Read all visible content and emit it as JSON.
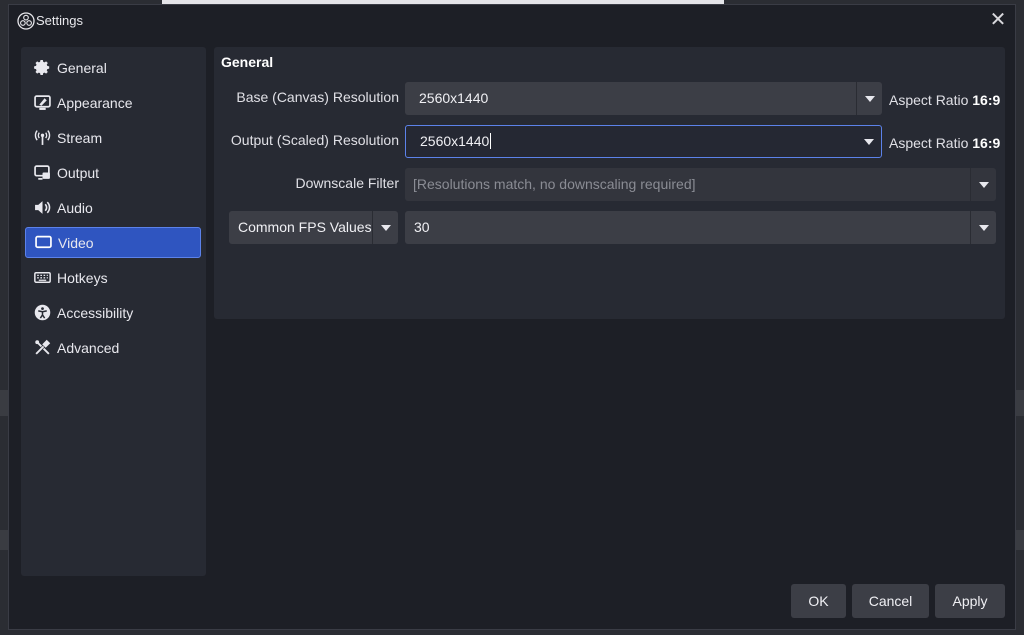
{
  "window": {
    "title": "Settings"
  },
  "sidebar": {
    "items": [
      {
        "label": "General",
        "icon": "gear-icon"
      },
      {
        "label": "Appearance",
        "icon": "appearance-icon"
      },
      {
        "label": "Stream",
        "icon": "antenna-icon"
      },
      {
        "label": "Output",
        "icon": "output-icon"
      },
      {
        "label": "Audio",
        "icon": "speaker-icon"
      },
      {
        "label": "Video",
        "icon": "monitor-icon",
        "active": true
      },
      {
        "label": "Hotkeys",
        "icon": "keyboard-icon"
      },
      {
        "label": "Accessibility",
        "icon": "accessibility-icon"
      },
      {
        "label": "Advanced",
        "icon": "tools-icon"
      }
    ]
  },
  "video": {
    "section_title": "General",
    "base_resolution": {
      "label": "Base (Canvas) Resolution",
      "value": "2560x1440",
      "aspect_label": "Aspect Ratio",
      "aspect_value": "16:9"
    },
    "output_resolution": {
      "label": "Output (Scaled) Resolution",
      "value": "2560x1440",
      "aspect_label": "Aspect Ratio",
      "aspect_value": "16:9"
    },
    "downscale_filter": {
      "label": "Downscale Filter",
      "value": "[Resolutions match, no downscaling required]"
    },
    "fps": {
      "type_value": "Common FPS Values",
      "value": "30"
    }
  },
  "buttons": {
    "ok": "OK",
    "cancel": "Cancel",
    "apply": "Apply"
  },
  "colors": {
    "accent": "#2f55c0",
    "window_bg": "#1d1f26",
    "panel_bg": "#272a33",
    "field_bg": "#3c3e46"
  }
}
